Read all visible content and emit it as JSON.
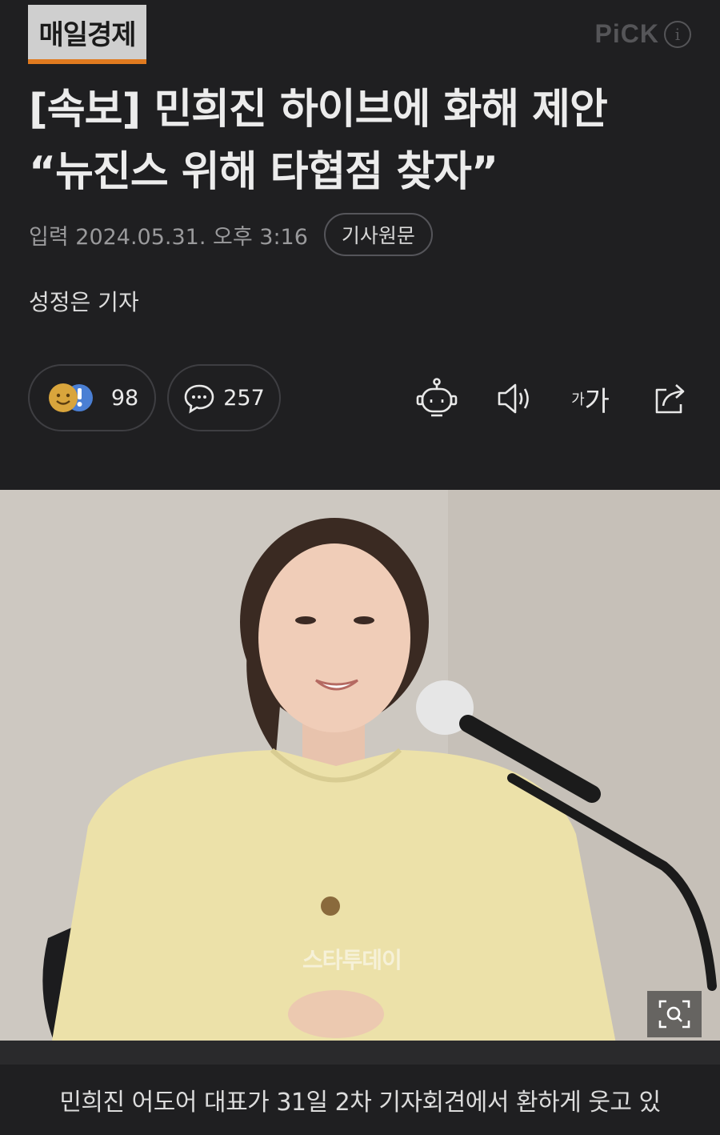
{
  "header": {
    "publisher_logo": "매일경제",
    "pick_label": "PiCK",
    "pick_info": "i"
  },
  "article": {
    "headline_line1": "[속보] 민희진 하이브에 화해 제안",
    "headline_line2": "“뉴진스 위해 타협점 찾자”",
    "published": "입력 2024.05.31. 오후 3:16",
    "original_button": "기사원문",
    "reporter": "성정은 기자"
  },
  "actions": {
    "reaction_count": "98",
    "comment_count": "257",
    "font_small": "가",
    "font_big": "가"
  },
  "photo": {
    "watermark": "스타투데이",
    "caption": "민희진 어도어 대표가 31일 2차 기자회견에서 환하게 웃고 있"
  },
  "colors": {
    "background": "#1f1f21",
    "logo_accent": "#e07a1f"
  }
}
